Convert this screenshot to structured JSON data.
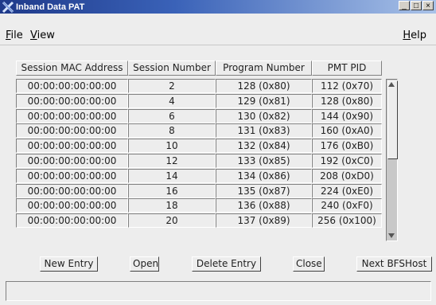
{
  "window": {
    "title": "Inband Data PAT"
  },
  "menu": {
    "file_label": "ile",
    "file_mnemonic": "F",
    "view_label": "iew",
    "view_mnemonic": "V",
    "help_label": "elp",
    "help_mnemonic": "H"
  },
  "table": {
    "headers": [
      "Session MAC Address",
      "Session Number",
      "Program Number",
      "PMT PID"
    ],
    "rows": [
      [
        "00:00:00:00:00:00",
        "2",
        "128 (0x80)",
        "112 (0x70)"
      ],
      [
        "00:00:00:00:00:00",
        "4",
        "129 (0x81)",
        "128 (0x80)"
      ],
      [
        "00:00:00:00:00:00",
        "6",
        "130 (0x82)",
        "144 (0x90)"
      ],
      [
        "00:00:00:00:00:00",
        "8",
        "131 (0x83)",
        "160 (0xA0)"
      ],
      [
        "00:00:00:00:00:00",
        "10",
        "132 (0x84)",
        "176 (0xB0)"
      ],
      [
        "00:00:00:00:00:00",
        "12",
        "133 (0x85)",
        "192 (0xC0)"
      ],
      [
        "00:00:00:00:00:00",
        "14",
        "134 (0x86)",
        "208 (0xD0)"
      ],
      [
        "00:00:00:00:00:00",
        "16",
        "135 (0x87)",
        "224 (0xE0)"
      ],
      [
        "00:00:00:00:00:00",
        "18",
        "136 (0x88)",
        "240 (0xF0)"
      ],
      [
        "00:00:00:00:00:00",
        "20",
        "137 (0x89)",
        "256 (0x100)"
      ]
    ]
  },
  "buttons": {
    "new_entry": "New Entry",
    "open": "Open",
    "delete_entry": "Delete Entry",
    "close": "Close",
    "next": "Next BFSHost"
  },
  "icons": {
    "app": "x-logo-icon"
  },
  "colors": {
    "titlebar": "#1f3a8a",
    "background": "#ededed"
  }
}
